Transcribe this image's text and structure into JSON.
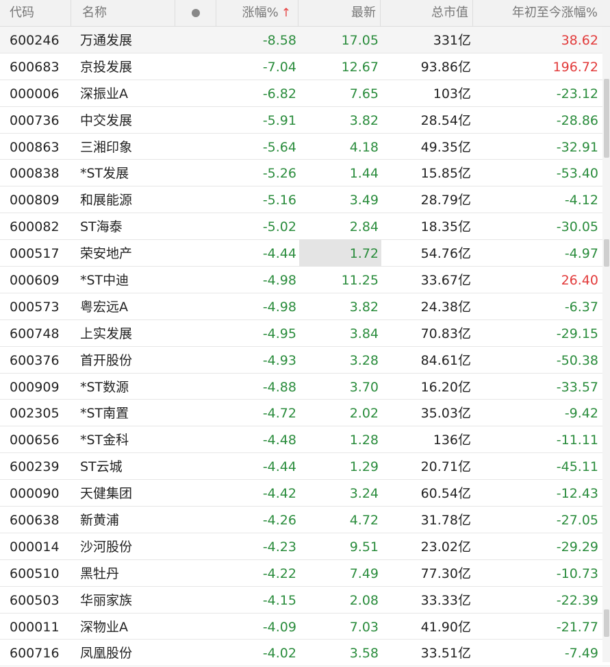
{
  "header": {
    "code": "代码",
    "name": "名称",
    "change_pct": "涨幅%",
    "sort_arrow": "↑",
    "latest": "最新",
    "market_cap": "总市值",
    "ytd_pct": "年初至今涨幅%"
  },
  "colors": {
    "down": "#2a8c3c",
    "up": "#e23a3a",
    "header_bg": "#f2f2f2"
  },
  "rows": [
    {
      "code": "600246",
      "name": "万通发展",
      "chg": "-8.58",
      "last": "17.05",
      "cap": "331亿",
      "ytd": "38.62",
      "ytd_dir": "up"
    },
    {
      "code": "600683",
      "name": "京投发展",
      "chg": "-7.04",
      "last": "12.67",
      "cap": "93.86亿",
      "ytd": "196.72",
      "ytd_dir": "up"
    },
    {
      "code": "000006",
      "name": "深振业A",
      "chg": "-6.82",
      "last": "7.65",
      "cap": "103亿",
      "ytd": "-23.12",
      "ytd_dir": "down"
    },
    {
      "code": "000736",
      "name": "中交发展",
      "chg": "-5.91",
      "last": "3.82",
      "cap": "28.54亿",
      "ytd": "-28.86",
      "ytd_dir": "down"
    },
    {
      "code": "000863",
      "name": "三湘印象",
      "chg": "-5.64",
      "last": "4.18",
      "cap": "49.35亿",
      "ytd": "-32.91",
      "ytd_dir": "down"
    },
    {
      "code": "000838",
      "name": "*ST发展",
      "chg": "-5.26",
      "last": "1.44",
      "cap": "15.85亿",
      "ytd": "-53.40",
      "ytd_dir": "down"
    },
    {
      "code": "000809",
      "name": "和展能源",
      "chg": "-5.16",
      "last": "3.49",
      "cap": "28.79亿",
      "ytd": "-4.12",
      "ytd_dir": "down"
    },
    {
      "code": "600082",
      "name": "ST海泰",
      "chg": "-5.02",
      "last": "2.84",
      "cap": "18.35亿",
      "ytd": "-30.05",
      "ytd_dir": "down"
    },
    {
      "code": "000517",
      "name": "荣安地产",
      "chg": "-4.44",
      "last": "1.72",
      "cap": "54.76亿",
      "ytd": "-4.97",
      "ytd_dir": "down",
      "highlight": true
    },
    {
      "code": "000609",
      "name": "*ST中迪",
      "chg": "-4.98",
      "last": "11.25",
      "cap": "33.67亿",
      "ytd": "26.40",
      "ytd_dir": "up"
    },
    {
      "code": "000573",
      "name": "粤宏远A",
      "chg": "-4.98",
      "last": "3.82",
      "cap": "24.38亿",
      "ytd": "-6.37",
      "ytd_dir": "down"
    },
    {
      "code": "600748",
      "name": "上实发展",
      "chg": "-4.95",
      "last": "3.84",
      "cap": "70.83亿",
      "ytd": "-29.15",
      "ytd_dir": "down"
    },
    {
      "code": "600376",
      "name": "首开股份",
      "chg": "-4.93",
      "last": "3.28",
      "cap": "84.61亿",
      "ytd": "-50.38",
      "ytd_dir": "down"
    },
    {
      "code": "000909",
      "name": "*ST数源",
      "chg": "-4.88",
      "last": "3.70",
      "cap": "16.20亿",
      "ytd": "-33.57",
      "ytd_dir": "down"
    },
    {
      "code": "002305",
      "name": "*ST南置",
      "chg": "-4.72",
      "last": "2.02",
      "cap": "35.03亿",
      "ytd": "-9.42",
      "ytd_dir": "down"
    },
    {
      "code": "000656",
      "name": "*ST金科",
      "chg": "-4.48",
      "last": "1.28",
      "cap": "136亿",
      "ytd": "-11.11",
      "ytd_dir": "down"
    },
    {
      "code": "600239",
      "name": "ST云城",
      "chg": "-4.44",
      "last": "1.29",
      "cap": "20.71亿",
      "ytd": "-45.11",
      "ytd_dir": "down"
    },
    {
      "code": "000090",
      "name": "天健集团",
      "chg": "-4.42",
      "last": "3.24",
      "cap": "60.54亿",
      "ytd": "-12.43",
      "ytd_dir": "down"
    },
    {
      "code": "600638",
      "name": "新黄浦",
      "chg": "-4.26",
      "last": "4.72",
      "cap": "31.78亿",
      "ytd": "-27.05",
      "ytd_dir": "down"
    },
    {
      "code": "000014",
      "name": "沙河股份",
      "chg": "-4.23",
      "last": "9.51",
      "cap": "23.02亿",
      "ytd": "-29.29",
      "ytd_dir": "down"
    },
    {
      "code": "600510",
      "name": "黑牡丹",
      "chg": "-4.22",
      "last": "7.49",
      "cap": "77.30亿",
      "ytd": "-10.73",
      "ytd_dir": "down"
    },
    {
      "code": "600503",
      "name": "华丽家族",
      "chg": "-4.15",
      "last": "2.08",
      "cap": "33.33亿",
      "ytd": "-22.39",
      "ytd_dir": "down"
    },
    {
      "code": "000011",
      "name": "深物业A",
      "chg": "-4.09",
      "last": "7.03",
      "cap": "41.90亿",
      "ytd": "-21.77",
      "ytd_dir": "down"
    },
    {
      "code": "600716",
      "name": "凤凰股份",
      "chg": "-4.02",
      "last": "3.58",
      "cap": "33.51亿",
      "ytd": "-7.49",
      "ytd_dir": "down"
    }
  ]
}
